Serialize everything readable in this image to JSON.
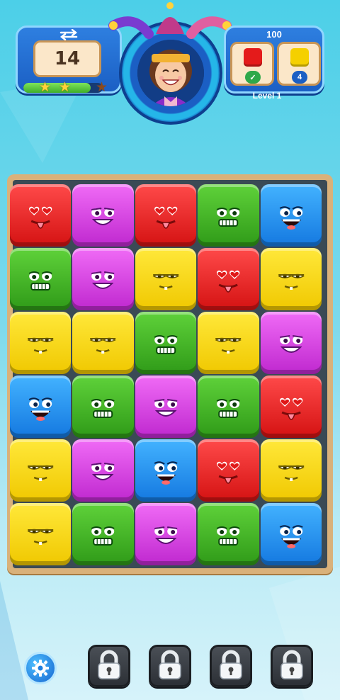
{
  "hud": {
    "moves_left": "14",
    "swap_icon": "swap-arrows-icon",
    "progress": {
      "fraction": 0.85,
      "stars": [
        true,
        true,
        false
      ]
    },
    "avatar": "jester-girl-avatar",
    "target": {
      "score": "100",
      "goals": [
        {
          "color": "#e41b1b",
          "status": "✓"
        },
        {
          "color": "#f5d000",
          "status": "4"
        }
      ]
    },
    "level_label": "Level 1"
  },
  "board": {
    "rows": [
      [
        "red",
        "purple",
        "red",
        "green",
        "blue"
      ],
      [
        "green",
        "purple",
        "yellow",
        "red",
        "yellow"
      ],
      [
        "yellow",
        "yellow",
        "green",
        "yellow",
        "purple"
      ],
      [
        "blue",
        "green",
        "purple",
        "green",
        "red"
      ],
      [
        "yellow",
        "purple",
        "blue",
        "red",
        "yellow"
      ],
      [
        "yellow",
        "green",
        "purple",
        "green",
        "blue"
      ]
    ]
  },
  "bottom_bar": {
    "settings_icon": "gear-icon",
    "boosters": [
      "locked",
      "locked",
      "locked",
      "locked"
    ]
  }
}
